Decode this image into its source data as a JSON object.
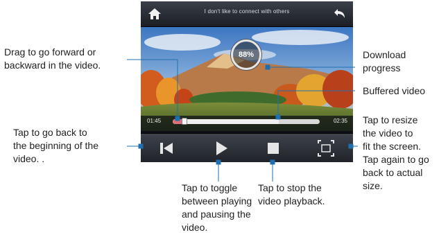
{
  "player": {
    "title": "I don't like to connect with others",
    "current_time": "01:45",
    "total_time": "02:35",
    "download_progress_label": "88%",
    "download_progress": 0.88,
    "played_fraction": 0.07,
    "buffered_fraction": 0.72,
    "icons": {
      "home": "home-icon",
      "back": "back-arrow-icon",
      "previous": "skip-to-start-icon",
      "play": "play-icon",
      "stop": "stop-icon",
      "fullscreen": "resize-icon"
    }
  },
  "callouts": {
    "drag": [
      "Drag to go forward or",
      "backward in the video."
    ],
    "download": [
      "Download",
      "progress"
    ],
    "buffered": [
      "Buffered video"
    ],
    "back_to_start": [
      "Tap to go back to",
      "the beginning of the",
      "video. ."
    ],
    "resize": [
      "Tap to resize",
      "the video to",
      "fit the screen.",
      "Tap again to go",
      "back to actual",
      "size."
    ],
    "toggle": [
      "Tap to toggle",
      "between playing",
      "and pausing the",
      "video."
    ],
    "stop": [
      "Tap to stop the",
      "video playback."
    ]
  },
  "colors": {
    "played": "#e07077",
    "leader": "#1f6fb0"
  }
}
